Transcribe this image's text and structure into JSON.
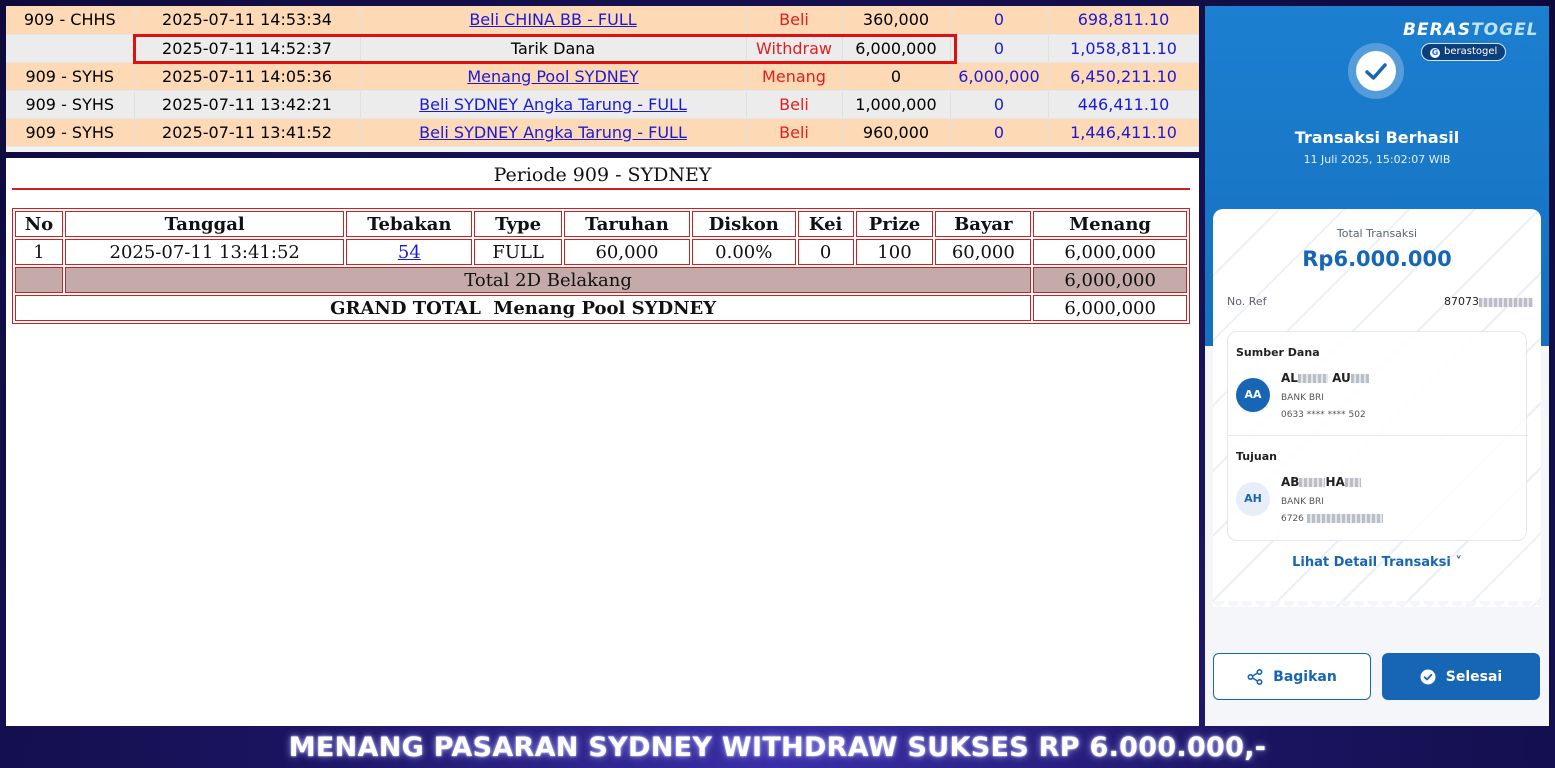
{
  "ledger": {
    "rows": [
      {
        "code": "909 - CHHS",
        "time": "2025-07-11 14:53:34",
        "desc": "Beli CHINA BB - FULL",
        "type": "Beli",
        "debit": "360,000",
        "credit": "0",
        "balance": "698,811.10"
      },
      {
        "code": "",
        "time": "2025-07-11 14:52:37",
        "desc": "Tarik Dana",
        "type": "Withdraw",
        "debit": "6,000,000",
        "credit": "0",
        "balance": "1,058,811.10"
      },
      {
        "code": "909 - SYHS",
        "time": "2025-07-11 14:05:36",
        "desc": "Menang Pool SYDNEY",
        "type": "Menang",
        "debit": "0",
        "credit": "6,000,000",
        "balance": "6,450,211.10"
      },
      {
        "code": "909 - SYHS",
        "time": "2025-07-11 13:42:21",
        "desc": "Beli SYDNEY Angka Tarung - FULL",
        "type": "Beli",
        "debit": "1,000,000",
        "credit": "0",
        "balance": "446,411.10"
      },
      {
        "code": "909 - SYHS",
        "time": "2025-07-11 13:41:52",
        "desc": "Beli SYDNEY Angka Tarung - FULL",
        "type": "Beli",
        "debit": "960,000",
        "credit": "0",
        "balance": "1,446,411.10"
      }
    ]
  },
  "report": {
    "periode": "Periode 909 - SYDNEY",
    "headers": [
      "No",
      "Tanggal",
      "Tebakan",
      "Type",
      "Taruhan",
      "Diskon",
      "Kei",
      "Prize",
      "Bayar",
      "Menang"
    ],
    "row": {
      "no": "1",
      "tanggal": "2025-07-11 13:41:52",
      "tebakan": "54",
      "type": "FULL",
      "taruhan": "60,000",
      "diskon": "0.00%",
      "kei": "0",
      "prize": "100",
      "bayar": "60,000",
      "menang": "6,000,000"
    },
    "subtotal_label": "Total 2D Belakang",
    "subtotal_value": "6,000,000",
    "grand_label": "GRAND TOTAL  Menang Pool SYDNEY",
    "grand_value": "6,000,000"
  },
  "receipt": {
    "logo_text_a": "BERAS",
    "logo_text_b": "TOGEL",
    "logo_chip": "berastogel",
    "title": "Transaksi Berhasil",
    "datetime": "11 Juli 2025, 15:02:07 WIB",
    "total_label": "Total Transaksi",
    "total_amount": "Rp6.000.000",
    "ref_label": "No. Ref",
    "ref_value": "87073",
    "source_label": "Sumber Dana",
    "source_initials": "AA",
    "source_name_a": "AL",
    "source_name_b": " AU",
    "source_bank": "BANK BRI",
    "source_account": "0633 **** **** 502",
    "dest_label": "Tujuan",
    "dest_initials": "AH",
    "dest_name_a": "AB",
    "dest_name_b": "HA",
    "dest_bank": "BANK BRI",
    "dest_account": "6726",
    "detail_link": "Lihat Detail Transaksi ˅",
    "share_button": "Bagikan",
    "done_button": "Selesai",
    "accent": "#1766b6"
  },
  "banner": {
    "text": "MENANG PASARAN SYDNEY WITHDRAW SUKSES RP 6.000.000,-"
  }
}
